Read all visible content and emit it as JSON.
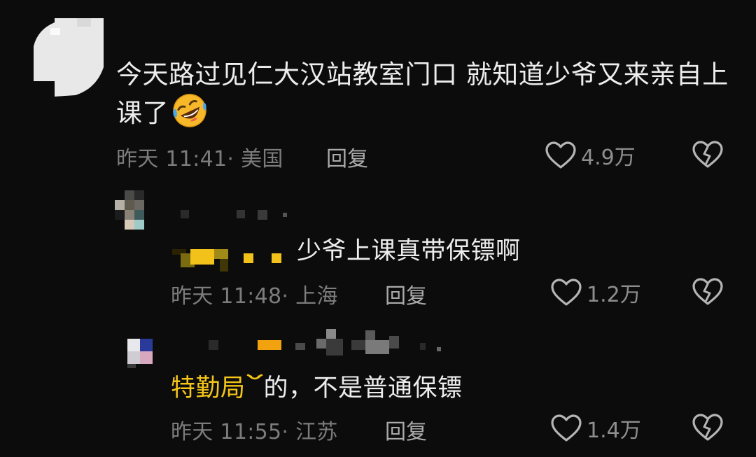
{
  "main_comment": {
    "text": "今天路过见仁大汉站教室门口 就知道少爷又来亲自上课了",
    "emoji": "rolling-on-floor-laughing-emoji",
    "time": "昨天 11:41",
    "location": "· 美国",
    "reply_label": "回复",
    "likes": "4.9万"
  },
  "replies": [
    {
      "reply_to_text": "少爷上课真带保镖啊",
      "time": "昨天 11:48",
      "location": "· 上海",
      "reply_label": "回复",
      "likes": "1.2万"
    },
    {
      "text_highlight": "特勤局",
      "text_rest": "的，不是普通保镖",
      "time": "昨天 11:55",
      "location": "· 江苏",
      "reply_label": "回复",
      "likes": "1.4万"
    }
  ],
  "colors": {
    "background": "#0c0c0c",
    "text": "#ededed",
    "meta": "#7c7c7c",
    "highlight": "#f5c518"
  }
}
